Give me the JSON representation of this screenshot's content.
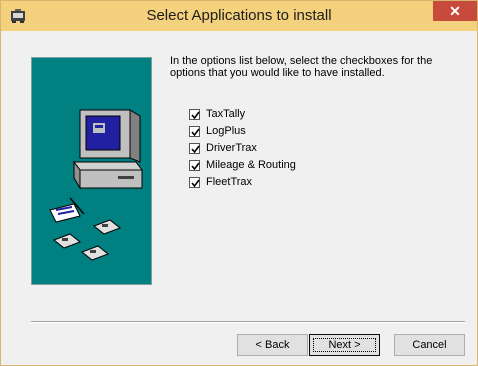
{
  "window": {
    "title": "Select Applications to install",
    "close_glyph": "✕"
  },
  "instruction": "In the options list below, select the checkboxes for the options that you would like to have installed.",
  "options": [
    {
      "label": "TaxTally",
      "checked": true
    },
    {
      "label": "LogPlus",
      "checked": true
    },
    {
      "label": "DriverTrax",
      "checked": true
    },
    {
      "label": "Mileage & Routing",
      "checked": true
    },
    {
      "label": "FleetTrax",
      "checked": true
    }
  ],
  "buttons": {
    "back": "< Back",
    "next": "Next >",
    "cancel": "Cancel"
  },
  "colors": {
    "titlebar": "#f3d17d",
    "close": "#c74b3d",
    "art_panel": "#008080"
  },
  "icons": {
    "app": "installer-icon",
    "close": "close-icon",
    "art": "computer-with-disks-illustration"
  }
}
